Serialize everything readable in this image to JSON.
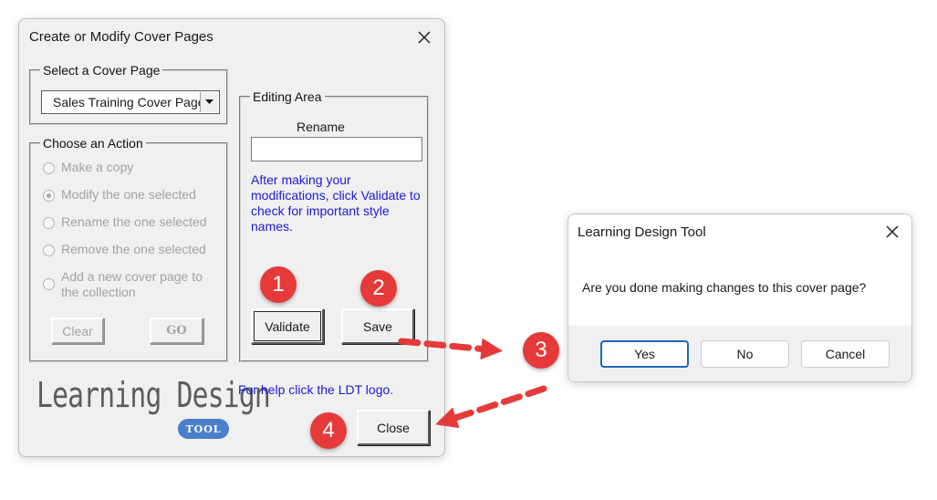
{
  "main_dialog": {
    "title": "Create or Modify Cover Pages",
    "select_group": {
      "legend": "Select a Cover Page",
      "selected_value": "Sales Training Cover Page"
    },
    "action_group": {
      "legend": "Choose an Action",
      "options": [
        {
          "label": "Make a copy",
          "checked": false,
          "enabled": false
        },
        {
          "label": "Modify the one selected",
          "checked": true,
          "enabled": false
        },
        {
          "label": "Rename the one selected",
          "checked": false,
          "enabled": false
        },
        {
          "label": "Remove the one selected",
          "checked": false,
          "enabled": false
        },
        {
          "label": "Add a new cover page to the collection",
          "checked": false,
          "enabled": false
        }
      ],
      "clear_label": "Clear",
      "go_label": "GO"
    },
    "editing_group": {
      "legend": "Editing Area",
      "rename_label": "Rename",
      "rename_value": "",
      "note": "After making your modifications, click Validate to check for important style names.",
      "validate_label": "Validate",
      "save_label": "Save"
    },
    "help_text": "For help click the LDT logo.",
    "logo": {
      "text": "Learning Design",
      "badge": "TOOL"
    },
    "close_label": "Close"
  },
  "confirm_dialog": {
    "title": "Learning Design Tool",
    "message": "Are you done making changes to this cover page?",
    "yes_label": "Yes",
    "no_label": "No",
    "cancel_label": "Cancel"
  },
  "callouts": {
    "step1": "1",
    "step2": "2",
    "step3": "3",
    "step4": "4"
  },
  "colors": {
    "callout": "#e53a3a",
    "link_text": "#1a1ad6",
    "primary_button_border": "#1f66c1",
    "logo_badge": "#4a7fc9"
  }
}
